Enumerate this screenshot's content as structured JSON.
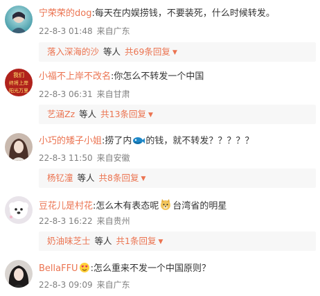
{
  "comments": [
    {
      "username": "宁荣荣的dog",
      "colon": ":",
      "text": "每天在内娱捞钱，不要装死，什么时候转发。",
      "date": "22-8-3 01:48",
      "source": "来自广东",
      "reply": {
        "name": "落入深海的沙",
        "etc": "等人",
        "count": "共69条回复"
      }
    },
    {
      "username": "小福不上岸不改名",
      "colon": ":",
      "text": "你怎么不转发一个中国",
      "date": "22-8-3 06:31",
      "source": "来自甘肃",
      "reply": {
        "name": "艺涵Zz",
        "etc": "等人",
        "count": "共13条回复"
      }
    },
    {
      "username": "小巧的矮子小姐",
      "colon": ":",
      "text_before": "捞了内",
      "text_after": "的钱，就不转发？？？？？",
      "date": "22-8-3 11:50",
      "source": "来自安徽",
      "reply": {
        "name": "杨钇潼",
        "etc": "等人",
        "count": "共8条回复"
      }
    },
    {
      "username": "豆花儿是村花",
      "colon": ":",
      "text_before": "怎么木有表态呢",
      "text_after": "台湾省的明星",
      "date": "22-8-3 16:22",
      "source": "来自贵州",
      "reply": {
        "name": "奶油味芝士",
        "etc": "等人",
        "count": "共1条回复"
      }
    },
    {
      "username": "BellaFFU",
      "colon": ":",
      "text": "怎么重来不发一个中国原则？",
      "date": "22-8-3 09:09",
      "source": "来自广东"
    }
  ],
  "avatar2_text": [
    "我们",
    "终将上岸",
    "阳光万里"
  ],
  "colors": {
    "username": "#eb7350",
    "meta": "#808080",
    "replybg": "#f7f7f7"
  }
}
